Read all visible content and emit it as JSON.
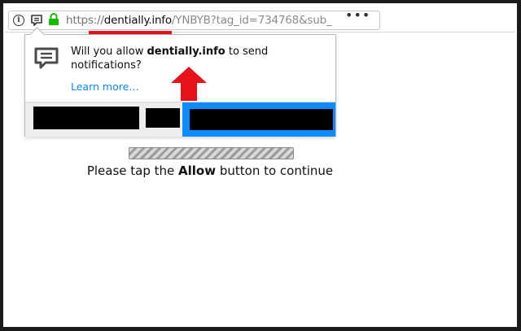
{
  "urlbar": {
    "info_icon_glyph": "i",
    "url_prefix": "https://",
    "url_host": "dentially.info",
    "url_path": "/YNBYB?tag_id=734768&sub_",
    "menu_label": "•••"
  },
  "popup": {
    "message_before": "Will you allow ",
    "message_host": "dentially.info",
    "message_after": " to send notifications?",
    "learn_more": "Learn more…"
  },
  "page": {
    "tap_before": "Please tap the ",
    "tap_bold": "Allow",
    "tap_after": " button to continue"
  },
  "colors": {
    "accent_blue": "#0a8cff",
    "annotation_red": "#e5121a",
    "lock_green": "#12bc00"
  },
  "icons": [
    "info-icon",
    "notification-icon",
    "lock-icon",
    "menu-dots-icon",
    "red-arrow-annotation"
  ]
}
